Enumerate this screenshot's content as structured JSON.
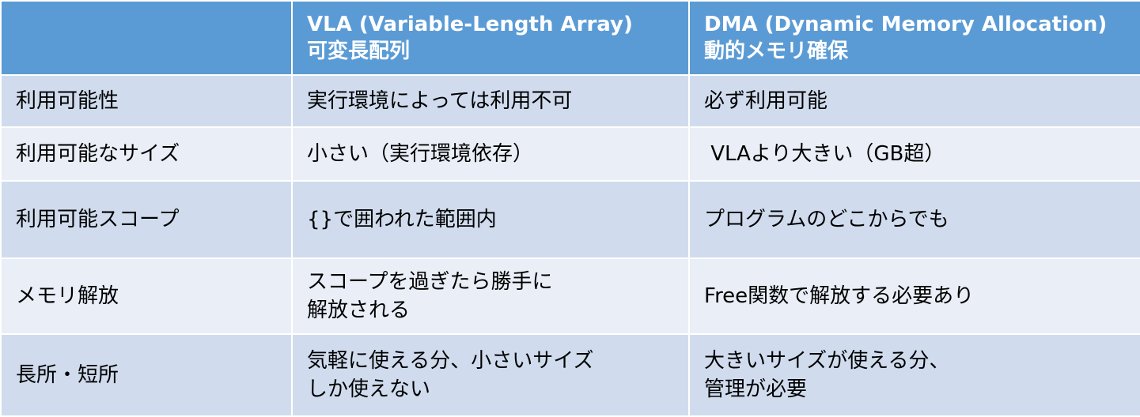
{
  "header": {
    "corner": "",
    "vla_line1": "VLA (Variable-Length Array)",
    "vla_line2": "可変長配列",
    "dma_line1": "DMA (Dynamic Memory Allocation)",
    "dma_line2": "動的メモリ確保"
  },
  "rows": [
    {
      "label": "利用可能性",
      "vla": [
        "実行環境によっては利用不可"
      ],
      "dma": [
        "必ず利用可能"
      ]
    },
    {
      "label": "利用可能なサイズ",
      "vla": [
        "小さい（実行環境依存）"
      ],
      "dma": [
        " VLAより大きい（GB超）"
      ]
    },
    {
      "label": "利用可能スコープ",
      "vla": [
        "{}で囲われた範囲内"
      ],
      "dma": [
        "プログラムのどこからでも"
      ]
    },
    {
      "label": "メモリ解放",
      "vla": [
        "スコープを過ぎたら勝手に",
        "解放される"
      ],
      "dma": [
        "Free関数で解放する必要あり"
      ]
    },
    {
      "label": "長所・短所",
      "vla": [
        "気軽に使える分、小さいサイズ",
        "しか使えない"
      ],
      "dma": [
        "大きいサイズが使える分、",
        "管理が必要"
      ]
    }
  ],
  "colors": {
    "header_bg": "#5b9bd5",
    "row_odd_bg": "#d0dcee",
    "row_even_bg": "#e9eef7",
    "border": "#ffffff"
  }
}
